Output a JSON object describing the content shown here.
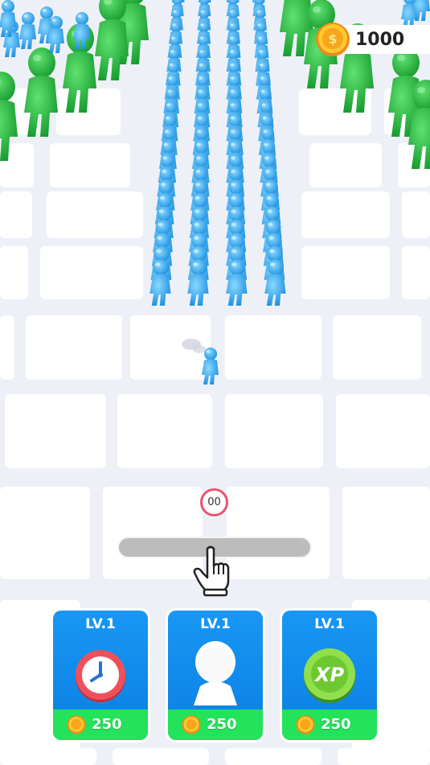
{
  "hud": {
    "coins": "1000",
    "coin_icon": "gold-coin-icon"
  },
  "game": {
    "timer": "00",
    "drag_hint_icon": "pointing-hand-icon"
  },
  "upgrades": [
    {
      "level": "LV.1",
      "price": "250",
      "icon": "clock-icon"
    },
    {
      "level": "LV.1",
      "price": "250",
      "icon": "stickman-icon"
    },
    {
      "level": "LV.1",
      "price": "250",
      "icon": "xp-coin-icon"
    }
  ],
  "colors": {
    "blue_crowd": "#33aef5",
    "green_enemy": "#1fc23f",
    "card_blue": "#1593f0",
    "card_green": "#22e35a",
    "timer_ring": "#e85470"
  }
}
